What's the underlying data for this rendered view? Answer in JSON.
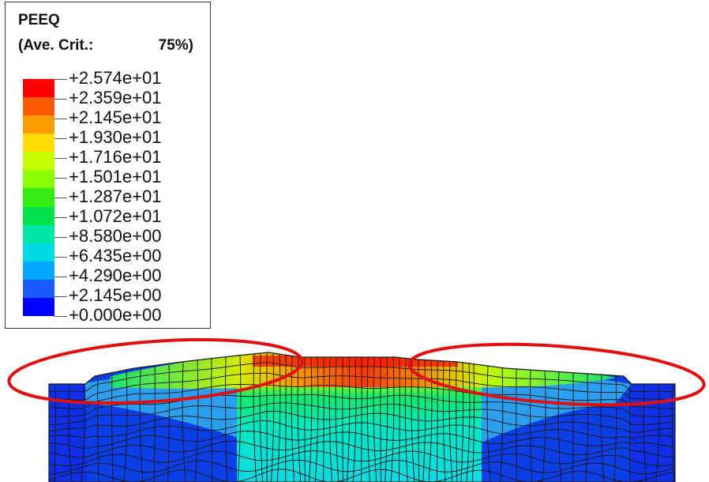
{
  "legend": {
    "title": "PEEQ",
    "crit_label": "(Ave. Crit.:",
    "crit_value": "75%)",
    "labels": [
      "+2.574e+01",
      "+2.359e+01",
      "+2.145e+01",
      "+1.930e+01",
      "+1.716e+01",
      "+1.501e+01",
      "+1.287e+01",
      "+1.072e+01",
      "+8.580e+00",
      "+6.435e+00",
      "+4.290e+00",
      "+2.145e+00",
      "+0.000e+00"
    ],
    "colors": [
      "#ff0000",
      "#ff5a00",
      "#ff9c00",
      "#ffdb00",
      "#c6ff00",
      "#8aff00",
      "#34ec12",
      "#00e34a",
      "#00e8a7",
      "#00dbe3",
      "#00a6ff",
      "#1a5cff",
      "#0000ff"
    ]
  },
  "mesh": {
    "colors": {
      "background": "#0d3fe6",
      "deep_blue": "#1030e8",
      "cyan": "#11d8e4",
      "light_blue": "#2fa8f0",
      "green": "#16e86a",
      "yellow": "#d6f000",
      "orange": "#ff8a00",
      "red": "#ff1a00",
      "highlight_ellipse": "#e01010"
    }
  }
}
